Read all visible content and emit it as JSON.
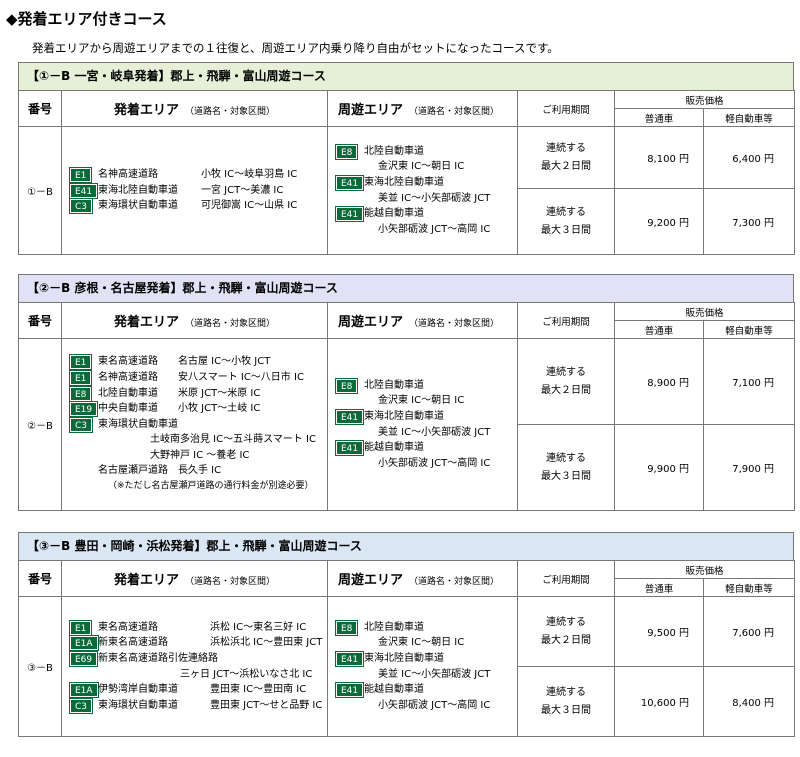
{
  "page": {
    "title": "◆発着エリア付きコース",
    "intro": "発着エリアから周遊エリアまでの１往復と、周遊エリア内乗り降り自由がセットになったコースです。"
  },
  "headers": {
    "number": "番号",
    "departure": "発着エリア",
    "departure_sub": "（道路名・対象区間）",
    "tour": "周遊エリア",
    "tour_sub": "（道路名・対象区間）",
    "period": "ご利用期間",
    "price": "販売価格",
    "regular": "普通車",
    "kei": "軽自動車等"
  },
  "courses": [
    {
      "banner": "【①－B 一宮・岐阜発着】郡上・飛騨・富山周遊コース",
      "banner_color": "#e6f0d7",
      "number": "①－B",
      "departure": [
        {
          "badge": "E1",
          "road": "名神高速道路",
          "section": "小牧 IC～岐阜羽島 IC"
        },
        {
          "badge": "E41",
          "road": "東海北陸自動車道",
          "section": "一宮 JCT～美濃 IC"
        },
        {
          "badge": "C3",
          "road": "東海環状自動車道",
          "section": "可児御嵩 IC～山県 IC"
        }
      ],
      "tour": [
        {
          "badge": "E8",
          "road": "北陸自動車道"
        },
        {
          "text": "金沢東 IC～朝日 IC"
        },
        {
          "badge": "E41",
          "road": "東海北陸自動車道"
        },
        {
          "text": "美並 IC～小矢部砺波 JCT"
        },
        {
          "badge": "E41",
          "road": "能越自動車道"
        },
        {
          "text": "小矢部砺波 JCT～高岡 IC"
        }
      ],
      "plans": [
        {
          "period_line1": "連続する",
          "period_line2": "最大２日間",
          "regular": "8,100 円",
          "kei": "6,400 円"
        },
        {
          "period_line1": "連続する",
          "period_line2": "最大３日間",
          "regular": "9,200 円",
          "kei": "7,300 円"
        }
      ]
    },
    {
      "banner": "【②－B 彦根・名古屋発着】郡上・飛騨・富山周遊コース",
      "banner_color": "#e1e2f6",
      "number": "②－B",
      "departure": [
        {
          "badge": "E1",
          "road": "東名高速道路",
          "section": "名古屋 IC～小牧 JCT"
        },
        {
          "badge": "E1",
          "road": "名神高速道路",
          "section": "安八スマート IC～八日市 IC"
        },
        {
          "badge": "E8",
          "road": "北陸自動車道",
          "section": "米原 JCT～米原 IC"
        },
        {
          "badge": "E19",
          "road": "中央自動車道",
          "section": "小牧 JCT～土岐 IC"
        },
        {
          "badge": "C3",
          "road": "東海環状自動車道"
        },
        {
          "text": "土岐南多治見 IC～五斗蒔スマート IC",
          "indent": 80
        },
        {
          "text": "大野神戸 IC ～養老 IC",
          "indent": 80
        },
        {
          "text": "名古屋瀬戸道路　長久手 IC",
          "indent": 28
        },
        {
          "text": "（※ただし名古屋瀬戸道路の通行料金が別途必要）",
          "indent": 38,
          "note": true
        }
      ],
      "tour": [
        {
          "badge": "E8",
          "road": "北陸自動車道"
        },
        {
          "text": "金沢東 IC～朝日 IC"
        },
        {
          "badge": "E41",
          "road": "東海北陸自動車道"
        },
        {
          "text": "美並 IC～小矢部砺波 JCT"
        },
        {
          "badge": "E41",
          "road": "能越自動車道"
        },
        {
          "text": "小矢部砺波 JCT～高岡 IC"
        }
      ],
      "plans": [
        {
          "period_line1": "連続する",
          "period_line2": "最大２日間",
          "regular": "8,900 円",
          "kei": "7,100 円"
        },
        {
          "period_line1": "連続する",
          "period_line2": "最大３日間",
          "regular": "9,900 円",
          "kei": "7,900 円"
        }
      ]
    },
    {
      "banner": "【③－B 豊田・岡崎・浜松発着】郡上・飛騨・富山周遊コース",
      "banner_color": "#dbe6f4",
      "number": "③－B",
      "departure": [
        {
          "badge": "E1",
          "road": "東名高速道路",
          "section": "浜松 IC～東名三好 IC"
        },
        {
          "badge": "E1A",
          "road": "新東名高速道路",
          "section": "浜松浜北 IC～豊田東 JCT"
        },
        {
          "badge": "E69",
          "road": "新東名高速道路引佐連絡路"
        },
        {
          "text": "三ヶ日 JCT～浜松いなさ北 IC",
          "indent": 110
        },
        {
          "badge": "E1A",
          "road": "伊勢湾岸自動車道",
          "section": "豊田東 IC～豊田南 IC"
        },
        {
          "badge": "C3",
          "road": "東海環状自動車道",
          "section": "豊田東 JCT～せと品野 IC"
        }
      ],
      "tour": [
        {
          "badge": "E8",
          "road": "北陸自動車道"
        },
        {
          "text": "金沢東 IC～朝日 IC"
        },
        {
          "badge": "E41",
          "road": "東海北陸自動車道"
        },
        {
          "text": "美並 IC～小矢部砺波 JCT"
        },
        {
          "badge": "E41",
          "road": "能越自動車道"
        },
        {
          "text": "小矢部砺波 JCT～高岡 IC"
        }
      ],
      "plans": [
        {
          "period_line1": "連続する",
          "period_line2": "最大２日間",
          "regular": "9,500 円",
          "kei": "7,600 円"
        },
        {
          "period_line1": "連続する",
          "period_line2": "最大３日間",
          "regular": "10,600 円",
          "kei": "8,400 円"
        }
      ]
    }
  ]
}
